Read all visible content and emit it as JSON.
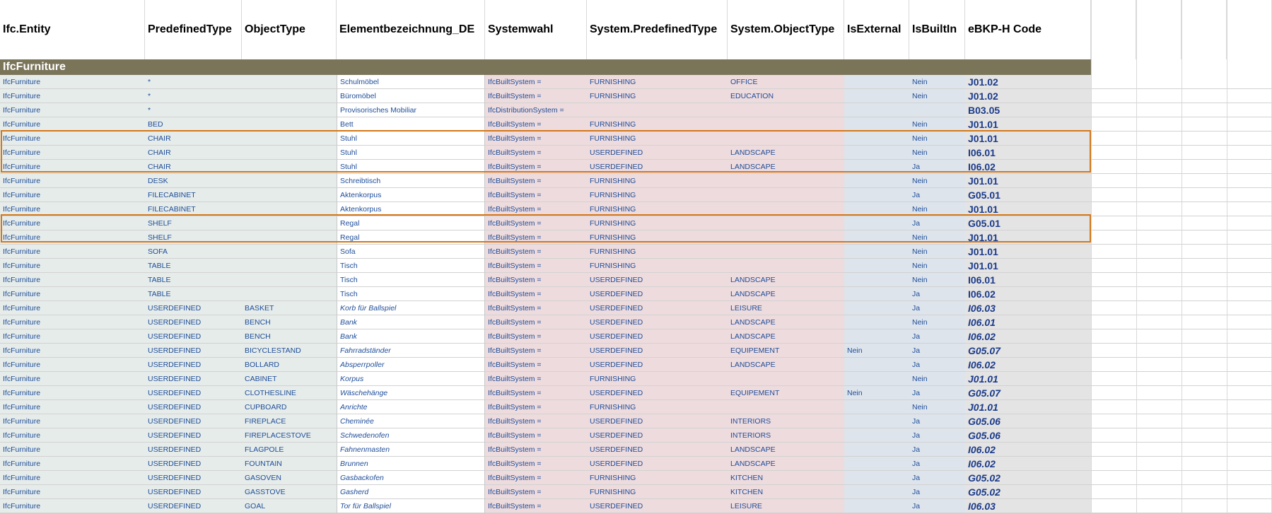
{
  "headers": [
    "Ifc.Entity",
    "PredefinedType",
    "ObjectType",
    "Elementbezeichnung_DE",
    "Systemwahl",
    "System.PredefinedType",
    "System.ObjectType",
    "IsExternal",
    "IsBuiltIn",
    "eBKP-H Code"
  ],
  "group_title": "IfcFurniture",
  "accent_colors": {
    "selection_border": "#d4781a",
    "group_bar": "#7a7459"
  },
  "rows": [
    {
      "entity": "IfcFurniture",
      "ptype": "*",
      "otype": "",
      "name": "Schulmöbel",
      "italic": false,
      "sys": "IfcBuiltSystem =",
      "sysptype": "FURNISHING",
      "sysotype": "OFFICE",
      "ext": "",
      "builtin": "Nein",
      "code": "J01.02"
    },
    {
      "entity": "IfcFurniture",
      "ptype": "*",
      "otype": "",
      "name": "Büromöbel",
      "italic": false,
      "sys": "IfcBuiltSystem =",
      "sysptype": "FURNISHING",
      "sysotype": "EDUCATION",
      "ext": "",
      "builtin": "Nein",
      "code": "J01.02"
    },
    {
      "entity": "IfcFurniture",
      "ptype": "*",
      "otype": "",
      "name": "Provisorisches Mobiliar",
      "italic": false,
      "sys": "IfcDistributionSystem =",
      "sysptype": "",
      "sysotype": "",
      "ext": "",
      "builtin": "",
      "code": "B03.05"
    },
    {
      "entity": "IfcFurniture",
      "ptype": "BED",
      "otype": "",
      "name": "Bett",
      "italic": false,
      "sys": "IfcBuiltSystem =",
      "sysptype": "FURNISHING",
      "sysotype": "",
      "ext": "",
      "builtin": "Nein",
      "code": "J01.01"
    },
    {
      "entity": "IfcFurniture",
      "ptype": "CHAIR",
      "otype": "",
      "name": "Stuhl",
      "italic": false,
      "sys": "IfcBuiltSystem =",
      "sysptype": "FURNISHING",
      "sysotype": "",
      "ext": "",
      "builtin": "Nein",
      "code": "J01.01"
    },
    {
      "entity": "IfcFurniture",
      "ptype": "CHAIR",
      "otype": "",
      "name": "Stuhl",
      "italic": false,
      "sys": "IfcBuiltSystem =",
      "sysptype": "USERDEFINED",
      "sysotype": "LANDSCAPE",
      "ext": "",
      "builtin": "Nein",
      "code": "I06.01"
    },
    {
      "entity": "IfcFurniture",
      "ptype": "CHAIR",
      "otype": "",
      "name": "Stuhl",
      "italic": false,
      "sys": "IfcBuiltSystem =",
      "sysptype": "USERDEFINED",
      "sysotype": "LANDSCAPE",
      "ext": "",
      "builtin": "Ja",
      "code": "I06.02"
    },
    {
      "entity": "IfcFurniture",
      "ptype": "DESK",
      "otype": "",
      "name": "Schreibtisch",
      "italic": false,
      "sys": "IfcBuiltSystem =",
      "sysptype": "FURNISHING",
      "sysotype": "",
      "ext": "",
      "builtin": "Nein",
      "code": "J01.01"
    },
    {
      "entity": "IfcFurniture",
      "ptype": "FILECABINET",
      "otype": "",
      "name": "Aktenkorpus",
      "italic": false,
      "sys": "IfcBuiltSystem =",
      "sysptype": "FURNISHING",
      "sysotype": "",
      "ext": "",
      "builtin": "Ja",
      "code": "G05.01"
    },
    {
      "entity": "IfcFurniture",
      "ptype": "FILECABINET",
      "otype": "",
      "name": "Aktenkorpus",
      "italic": false,
      "sys": "IfcBuiltSystem =",
      "sysptype": "FURNISHING",
      "sysotype": "",
      "ext": "",
      "builtin": "Nein",
      "code": "J01.01"
    },
    {
      "entity": "IfcFurniture",
      "ptype": "SHELF",
      "otype": "",
      "name": "Regal",
      "italic": false,
      "sys": "IfcBuiltSystem =",
      "sysptype": "FURNISHING",
      "sysotype": "",
      "ext": "",
      "builtin": "Ja",
      "code": "G05.01"
    },
    {
      "entity": "IfcFurniture",
      "ptype": "SHELF",
      "otype": "",
      "name": "Regal",
      "italic": false,
      "sys": "IfcBuiltSystem =",
      "sysptype": "FURNISHING",
      "sysotype": "",
      "ext": "",
      "builtin": "Nein",
      "code": "J01.01"
    },
    {
      "entity": "IfcFurniture",
      "ptype": "SOFA",
      "otype": "",
      "name": "Sofa",
      "italic": false,
      "sys": "IfcBuiltSystem =",
      "sysptype": "FURNISHING",
      "sysotype": "",
      "ext": "",
      "builtin": "Nein",
      "code": "J01.01"
    },
    {
      "entity": "IfcFurniture",
      "ptype": "TABLE",
      "otype": "",
      "name": "Tisch",
      "italic": false,
      "sys": "IfcBuiltSystem =",
      "sysptype": "FURNISHING",
      "sysotype": "",
      "ext": "",
      "builtin": "Nein",
      "code": "J01.01"
    },
    {
      "entity": "IfcFurniture",
      "ptype": "TABLE",
      "otype": "",
      "name": "Tisch",
      "italic": false,
      "sys": "IfcBuiltSystem =",
      "sysptype": "USERDEFINED",
      "sysotype": "LANDSCAPE",
      "ext": "",
      "builtin": "Nein",
      "code": "I06.01"
    },
    {
      "entity": "IfcFurniture",
      "ptype": "TABLE",
      "otype": "",
      "name": "Tisch",
      "italic": false,
      "sys": "IfcBuiltSystem =",
      "sysptype": "USERDEFINED",
      "sysotype": "LANDSCAPE",
      "ext": "",
      "builtin": "Ja",
      "code": "I06.02"
    },
    {
      "entity": "IfcFurniture",
      "ptype": "USERDEFINED",
      "otype": "BASKET",
      "name": "Korb für Ballspiel",
      "italic": true,
      "sys": "IfcBuiltSystem =",
      "sysptype": "USERDEFINED",
      "sysotype": "LEISURE",
      "ext": "",
      "builtin": "Ja",
      "code": "I06.03"
    },
    {
      "entity": "IfcFurniture",
      "ptype": "USERDEFINED",
      "otype": "BENCH",
      "name": "Bank",
      "italic": true,
      "sys": "IfcBuiltSystem =",
      "sysptype": "USERDEFINED",
      "sysotype": "LANDSCAPE",
      "ext": "",
      "builtin": "Nein",
      "code": "I06.01"
    },
    {
      "entity": "IfcFurniture",
      "ptype": "USERDEFINED",
      "otype": "BENCH",
      "name": "Bank",
      "italic": true,
      "sys": "IfcBuiltSystem =",
      "sysptype": "USERDEFINED",
      "sysotype": "LANDSCAPE",
      "ext": "",
      "builtin": "Ja",
      "code": "I06.02"
    },
    {
      "entity": "IfcFurniture",
      "ptype": "USERDEFINED",
      "otype": "BICYCLESTAND",
      "name": "Fahrradständer",
      "italic": true,
      "sys": "IfcBuiltSystem =",
      "sysptype": "USERDEFINED",
      "sysotype": "EQUIPEMENT",
      "ext": "Nein",
      "builtin": "Ja",
      "code": "G05.07"
    },
    {
      "entity": "IfcFurniture",
      "ptype": "USERDEFINED",
      "otype": "BOLLARD",
      "name": "Absperrpoller",
      "italic": true,
      "sys": "IfcBuiltSystem =",
      "sysptype": "USERDEFINED",
      "sysotype": "LANDSCAPE",
      "ext": "",
      "builtin": "Ja",
      "code": "I06.02"
    },
    {
      "entity": "IfcFurniture",
      "ptype": "USERDEFINED",
      "otype": "CABINET",
      "name": "Korpus",
      "italic": true,
      "sys": "IfcBuiltSystem =",
      "sysptype": "FURNISHING",
      "sysotype": "",
      "ext": "",
      "builtin": "Nein",
      "code": "J01.01"
    },
    {
      "entity": "IfcFurniture",
      "ptype": "USERDEFINED",
      "otype": "CLOTHESLINE",
      "name": "Wäschehänge",
      "italic": true,
      "sys": "IfcBuiltSystem =",
      "sysptype": "USERDEFINED",
      "sysotype": "EQUIPEMENT",
      "ext": "Nein",
      "builtin": "Ja",
      "code": "G05.07"
    },
    {
      "entity": "IfcFurniture",
      "ptype": "USERDEFINED",
      "otype": "CUPBOARD",
      "name": "Anrichte",
      "italic": true,
      "sys": "IfcBuiltSystem =",
      "sysptype": "FURNISHING",
      "sysotype": "",
      "ext": "",
      "builtin": "Nein",
      "code": "J01.01"
    },
    {
      "entity": "IfcFurniture",
      "ptype": "USERDEFINED",
      "otype": "FIREPLACE",
      "name": "Cheminée",
      "italic": true,
      "sys": "IfcBuiltSystem =",
      "sysptype": "USERDEFINED",
      "sysotype": "INTERIORS",
      "ext": "",
      "builtin": "Ja",
      "code": "G05.06"
    },
    {
      "entity": "IfcFurniture",
      "ptype": "USERDEFINED",
      "otype": "FIREPLACESTOVE",
      "name": "Schwedenofen",
      "italic": true,
      "sys": "IfcBuiltSystem =",
      "sysptype": "USERDEFINED",
      "sysotype": "INTERIORS",
      "ext": "",
      "builtin": "Ja",
      "code": "G05.06"
    },
    {
      "entity": "IfcFurniture",
      "ptype": "USERDEFINED",
      "otype": "FLAGPOLE",
      "name": "Fahnenmasten",
      "italic": true,
      "sys": "IfcBuiltSystem =",
      "sysptype": "USERDEFINED",
      "sysotype": "LANDSCAPE",
      "ext": "",
      "builtin": "Ja",
      "code": "I06.02"
    },
    {
      "entity": "IfcFurniture",
      "ptype": "USERDEFINED",
      "otype": "FOUNTAIN",
      "name": "Brunnen",
      "italic": true,
      "sys": "IfcBuiltSystem =",
      "sysptype": "USERDEFINED",
      "sysotype": "LANDSCAPE",
      "ext": "",
      "builtin": "Ja",
      "code": "I06.02"
    },
    {
      "entity": "IfcFurniture",
      "ptype": "USERDEFINED",
      "otype": "GASOVEN",
      "name": "Gasbackofen",
      "italic": true,
      "sys": "IfcBuiltSystem =",
      "sysptype": "FURNISHING",
      "sysotype": "KITCHEN",
      "ext": "",
      "builtin": "Ja",
      "code": "G05.02"
    },
    {
      "entity": "IfcFurniture",
      "ptype": "USERDEFINED",
      "otype": "GASSTOVE",
      "name": "Gasherd",
      "italic": true,
      "sys": "IfcBuiltSystem =",
      "sysptype": "FURNISHING",
      "sysotype": "KITCHEN",
      "ext": "",
      "builtin": "Ja",
      "code": "G05.02"
    },
    {
      "entity": "IfcFurniture",
      "ptype": "USERDEFINED",
      "otype": "GOAL",
      "name": "Tor für Ballspiel",
      "italic": true,
      "sys": "IfcBuiltSystem =",
      "sysptype": "USERDEFINED",
      "sysotype": "LEISURE",
      "ext": "",
      "builtin": "Ja",
      "code": "I06.03"
    }
  ]
}
